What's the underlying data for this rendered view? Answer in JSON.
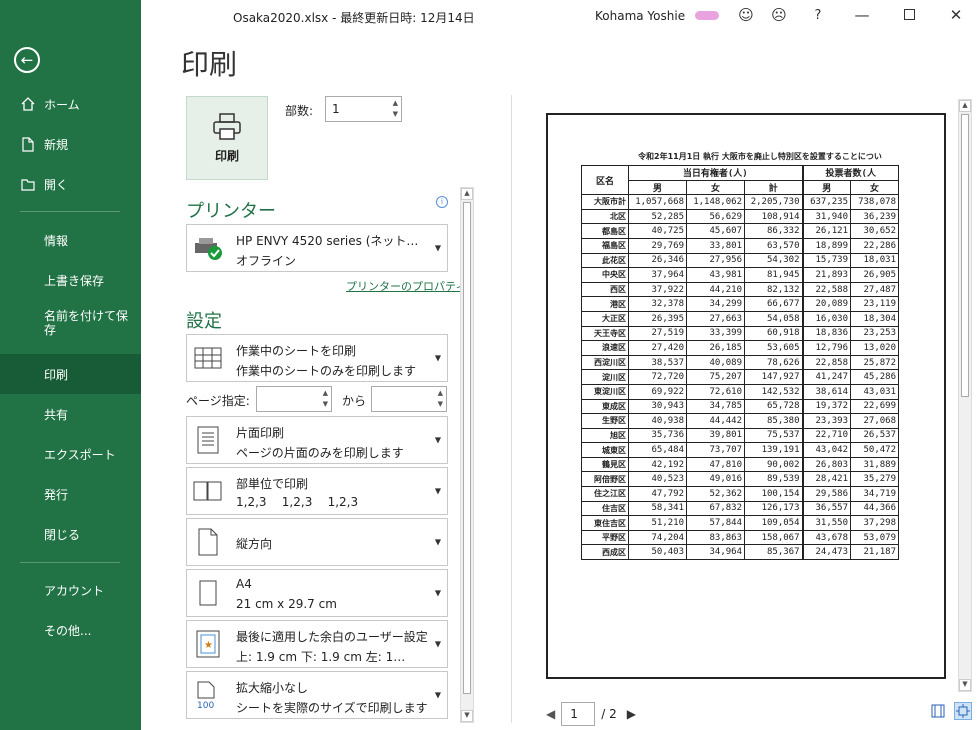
{
  "window": {
    "title": "Osaka2020.xlsx  -  最終更新日時: 12月14日",
    "user": "Kohama Yoshie",
    "help": "?"
  },
  "sidebar": {
    "items": [
      {
        "label": "ホーム",
        "icon": "home-icon"
      },
      {
        "label": "新規",
        "icon": "new-file-icon"
      },
      {
        "label": "開く",
        "icon": "folder-icon"
      },
      {
        "label": "情報"
      },
      {
        "label": "上書き保存"
      },
      {
        "label": "名前を付けて保",
        "label2": "存"
      },
      {
        "label": "印刷"
      },
      {
        "label": "共有"
      },
      {
        "label": "エクスポート"
      },
      {
        "label": "発行"
      },
      {
        "label": "閉じる"
      },
      {
        "label": "アカウント"
      },
      {
        "label": "その他..."
      }
    ]
  },
  "print": {
    "heading": "印刷",
    "button_label": "印刷",
    "copies_label": "部数:",
    "copies_value": "1",
    "printer_heading": "プリンター",
    "printer_name": "HP ENVY 4520 series (ネット…",
    "printer_status": "オフライン",
    "printer_properties": "プリンターのプロパティ",
    "settings_heading": "設定",
    "scope": {
      "line1": "作業中のシートを印刷",
      "line2": "作業中のシートのみを印刷します"
    },
    "pages_label": "ページ指定:",
    "pages_to": "から",
    "sides": {
      "line1": "片面印刷",
      "line2": "ページの片面のみを印刷します"
    },
    "collate": {
      "line1": "部単位で印刷",
      "line2": "1,2,3    1,2,3    1,2,3"
    },
    "orientation": {
      "line1": "縦方向"
    },
    "paper": {
      "line1": "A4",
      "line2": "21 cm x 29.7 cm"
    },
    "margins": {
      "line1": "最後に適用した余白のユーザー設定",
      "line2": "上: 1.9 cm 下: 1.9 cm 左: 1…"
    },
    "scaling": {
      "line1": "拡大縮小なし",
      "line2": "シートを実際のサイズで印刷します"
    }
  },
  "preview": {
    "title": "令和2年11月1日 執行  大阪市を廃止し特別区を設置することについ",
    "header_group1": "当日有権者(人)",
    "header_group2": "投票者数(人",
    "col_ward": "区名",
    "cols": [
      "男",
      "女",
      "計",
      "男",
      "女"
    ],
    "rows": [
      [
        "大阪市計",
        "1,057,668",
        "1,148,062",
        "2,205,730",
        "637,235",
        "738,078"
      ],
      [
        "北区",
        "52,285",
        "56,629",
        "108,914",
        "31,940",
        "36,239"
      ],
      [
        "都島区",
        "40,725",
        "45,607",
        "86,332",
        "26,121",
        "30,652"
      ],
      [
        "福島区",
        "29,769",
        "33,801",
        "63,570",
        "18,899",
        "22,286"
      ],
      [
        "此花区",
        "26,346",
        "27,956",
        "54,302",
        "15,739",
        "18,031"
      ],
      [
        "中央区",
        "37,964",
        "43,981",
        "81,945",
        "21,893",
        "26,905"
      ],
      [
        "西区",
        "37,922",
        "44,210",
        "82,132",
        "22,588",
        "27,487"
      ],
      [
        "港区",
        "32,378",
        "34,299",
        "66,677",
        "20,089",
        "23,119"
      ],
      [
        "大正区",
        "26,395",
        "27,663",
        "54,058",
        "16,030",
        "18,304"
      ],
      [
        "天王寺区",
        "27,519",
        "33,399",
        "60,918",
        "18,836",
        "23,253"
      ],
      [
        "浪速区",
        "27,420",
        "26,185",
        "53,605",
        "12,796",
        "13,020"
      ],
      [
        "西淀川区",
        "38,537",
        "40,089",
        "78,626",
        "22,858",
        "25,872"
      ],
      [
        "淀川区",
        "72,720",
        "75,207",
        "147,927",
        "41,247",
        "45,286"
      ],
      [
        "東淀川区",
        "69,922",
        "72,610",
        "142,532",
        "38,614",
        "43,031"
      ],
      [
        "東成区",
        "30,943",
        "34,785",
        "65,728",
        "19,372",
        "22,699"
      ],
      [
        "生野区",
        "40,938",
        "44,442",
        "85,380",
        "23,393",
        "27,068"
      ],
      [
        "旭区",
        "35,736",
        "39,801",
        "75,537",
        "22,710",
        "26,537"
      ],
      [
        "城東区",
        "65,484",
        "73,707",
        "139,191",
        "43,042",
        "50,472"
      ],
      [
        "鶴見区",
        "42,192",
        "47,810",
        "90,002",
        "26,803",
        "31,889"
      ],
      [
        "阿倍野区",
        "40,523",
        "49,016",
        "89,539",
        "28,421",
        "35,279"
      ],
      [
        "住之江区",
        "47,792",
        "52,362",
        "100,154",
        "29,586",
        "34,719"
      ],
      [
        "住吉区",
        "58,341",
        "67,832",
        "126,173",
        "36,557",
        "44,366"
      ],
      [
        "東住吉区",
        "51,210",
        "57,844",
        "109,054",
        "31,550",
        "37,298"
      ],
      [
        "平野区",
        "74,204",
        "83,863",
        "158,067",
        "43,678",
        "53,079"
      ],
      [
        "西成区",
        "50,403",
        "34,964",
        "85,367",
        "24,473",
        "21,187"
      ]
    ],
    "page_current": "1",
    "page_total": "/ 2"
  }
}
